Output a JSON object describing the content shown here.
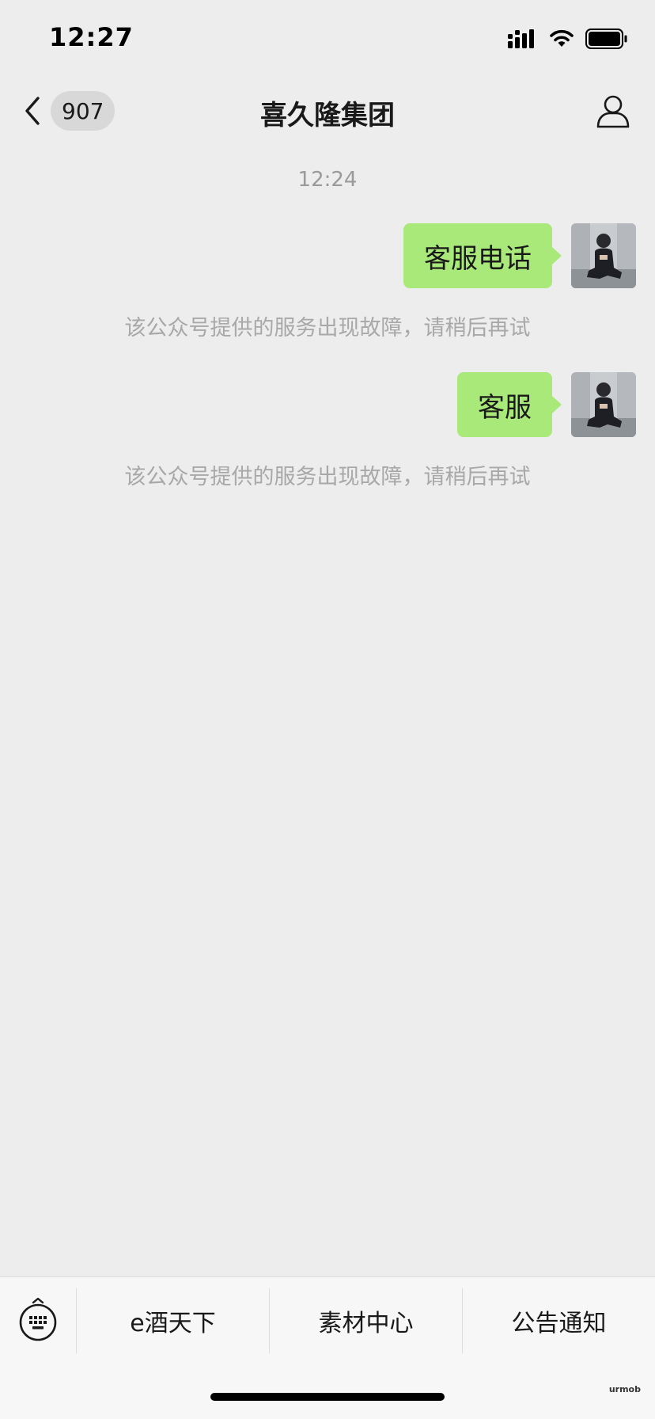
{
  "status_bar": {
    "time": "12:27"
  },
  "nav": {
    "unread_count": "907",
    "title": "喜久隆集团"
  },
  "chat": {
    "timestamp": "12:24",
    "messages": [
      {
        "text": "客服电话",
        "notice": "该公众号提供的服务出现故障，请稍后再试"
      },
      {
        "text": "客服",
        "notice": "该公众号提供的服务出现故障，请稍后再试"
      }
    ]
  },
  "menu": {
    "items": [
      {
        "label": "e酒天下"
      },
      {
        "label": "素材中心"
      },
      {
        "label": "公告通知"
      }
    ]
  },
  "watermark": "urmob"
}
